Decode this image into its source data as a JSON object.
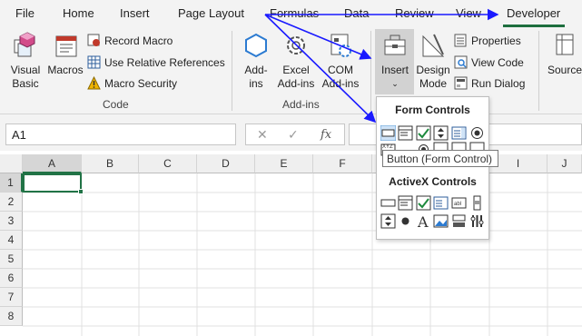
{
  "tabs": {
    "file": "File",
    "home": "Home",
    "insert": "Insert",
    "page_layout": "Page Layout",
    "formulas": "Formulas",
    "data": "Data",
    "review": "Review",
    "view": "View",
    "developer": "Developer"
  },
  "ribbon": {
    "visual_basic": [
      "Visual",
      "Basic"
    ],
    "macros": "Macros",
    "record_macro": "Record Macro",
    "relative_refs": "Use Relative References",
    "macro_security": "Macro Security",
    "code_group": "Code",
    "addins": [
      "Add-",
      "ins"
    ],
    "excel_addins": [
      "Excel",
      "Add-ins"
    ],
    "com_addins": [
      "COM",
      "Add-ins"
    ],
    "addins_group": "Add-ins",
    "insert": "Insert",
    "design_mode": [
      "Design",
      "Mode"
    ],
    "properties": "Properties",
    "view_code": "View Code",
    "run_dialog": "Run Dialog",
    "source": "Source"
  },
  "formula_bar": {
    "name_box": "A1",
    "fx": "fx"
  },
  "grid": {
    "columns": [
      "A",
      "B",
      "C",
      "D",
      "E",
      "F",
      "I",
      "J"
    ],
    "rows": [
      "1",
      "2",
      "3",
      "4",
      "5",
      "6",
      "7",
      "8"
    ]
  },
  "popup": {
    "form_controls": "Form Controls",
    "activex_controls": "ActiveX Controls",
    "tooltip": "Button (Form Control)"
  },
  "colors": {
    "accent": "#1e6f3e",
    "annotation": "#1a1aff"
  }
}
